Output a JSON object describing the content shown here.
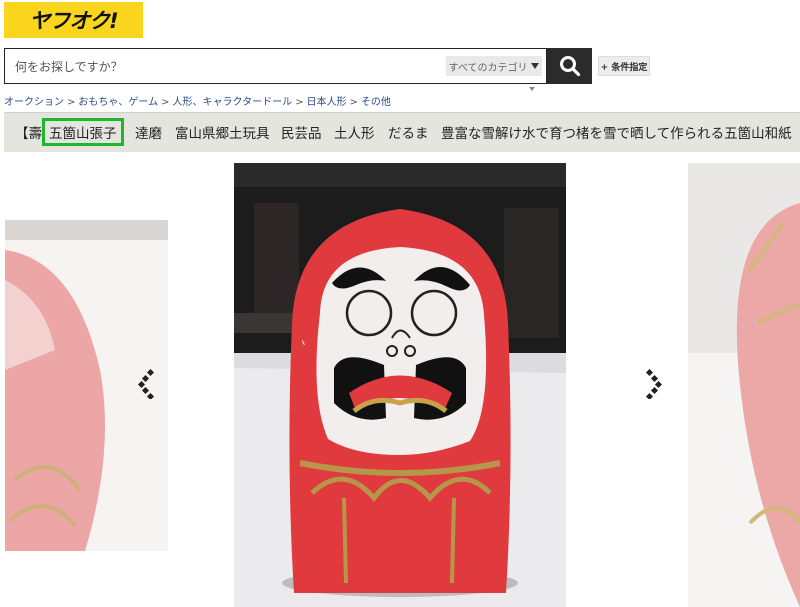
{
  "header": {
    "logo_text": "ヤフオク!",
    "search": {
      "placeholder": "何をお探しですか？",
      "category": "すべてのカテゴリ"
    },
    "condition_button": "+ 条件指定"
  },
  "breadcrumb": [
    "オークション",
    "おもちゃ、ゲーム",
    "人形、キャラクタードール",
    "日本人形",
    "その他"
  ],
  "tags": [
    "【壽",
    "五箇山張子",
    "達磨",
    "富山県郷土玩具",
    "民芸品",
    "土人形",
    "だるま",
    "豊富な雪解け水で育つ楮を雪で晒して作られる五箇山和紙"
  ],
  "highlighted_tag_index": 1,
  "icons": {
    "search": "search-icon",
    "prev": "chevron-left-icon",
    "next": "chevron-right-icon",
    "dropdown": "caret-down-icon"
  },
  "colors": {
    "logo_bg": "#f9d61d",
    "search_button_bg": "#2b2b2b",
    "tag_highlight": "#1fb52c",
    "link": "#2b4b8a",
    "daruma_red": "#e03a3e"
  }
}
